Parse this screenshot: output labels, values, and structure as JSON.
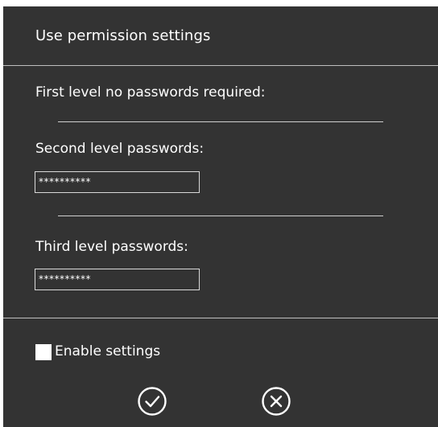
{
  "dialog": {
    "title": "Use permission settings"
  },
  "levels": {
    "first_label": "First level no passwords required:",
    "second_label": "Second level passwords:",
    "second_value": "**********",
    "third_label": "Third level  passwords:",
    "third_value": "**********"
  },
  "footer": {
    "enable_label": "Enable settings",
    "enable_checked": false,
    "confirm_icon": "check-circle-icon",
    "cancel_icon": "x-circle-icon"
  },
  "colors": {
    "background": "#333333",
    "text": "#ffffff",
    "divider": "#bfbfbf"
  }
}
